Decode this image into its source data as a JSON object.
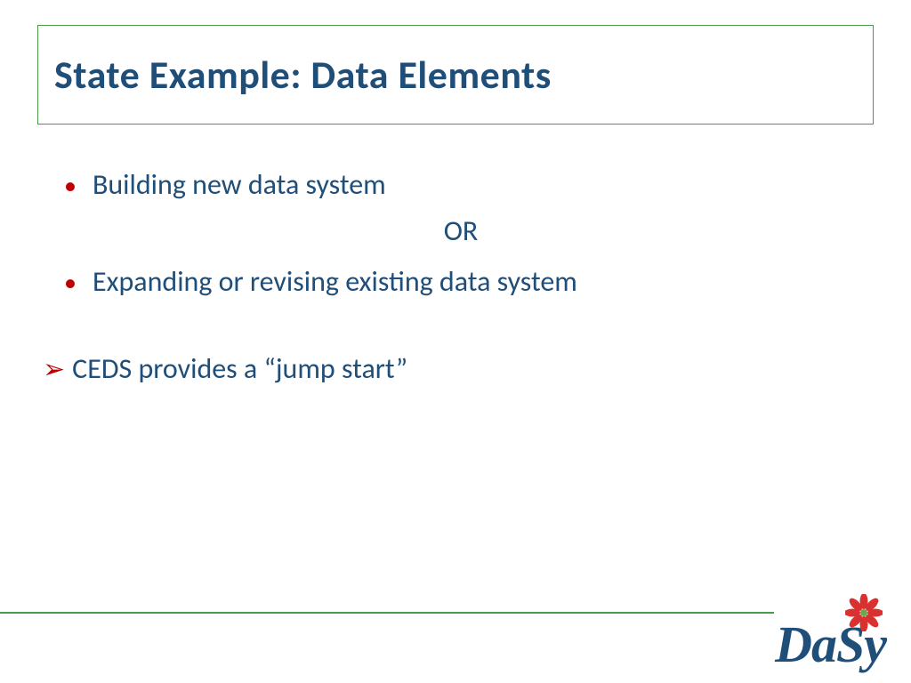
{
  "title": "State Example:  Data Elements",
  "bullets": {
    "b1": "Building new data system",
    "or": "OR",
    "b2": "Expanding or revising existing data system",
    "arrow": "CEDS provides a “jump start”"
  },
  "logo": {
    "text": "DaSy"
  }
}
